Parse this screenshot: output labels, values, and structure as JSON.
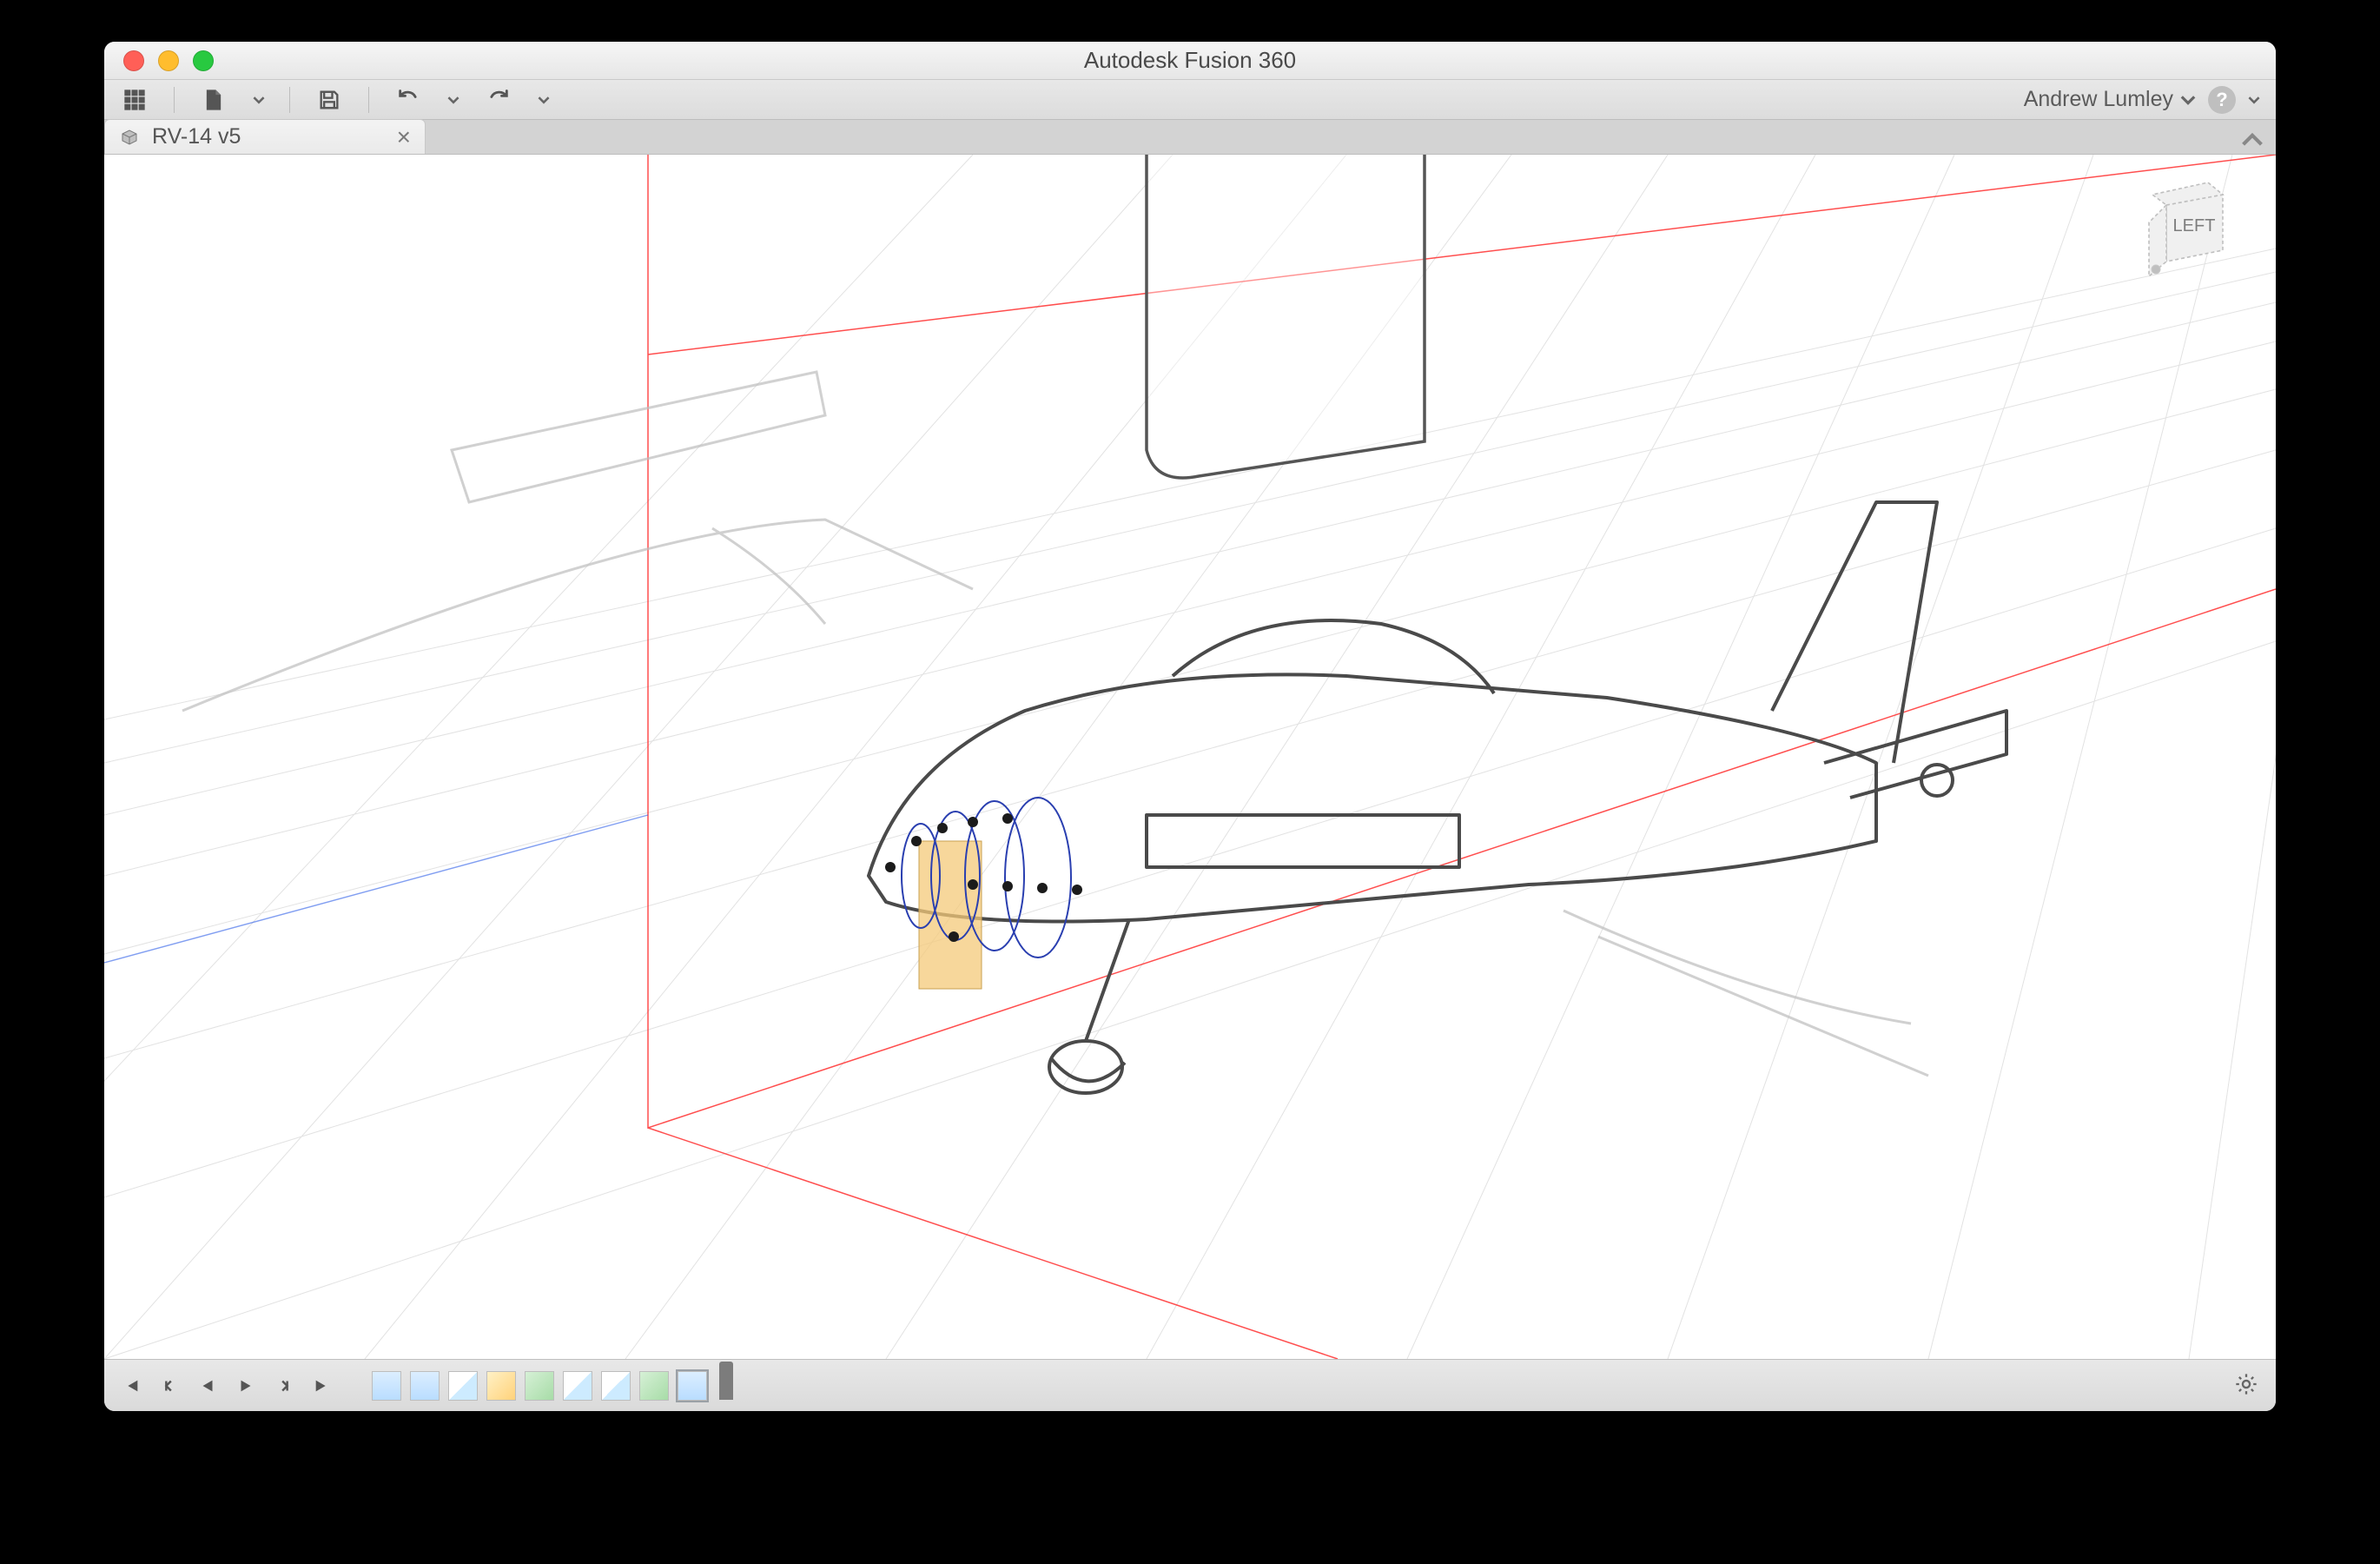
{
  "window": {
    "title": "Autodesk Fusion 360"
  },
  "user": {
    "name": "Andrew Lumley"
  },
  "tabs": [
    {
      "label": "RV-14 v5",
      "icon": "component-icon"
    }
  ],
  "viewcube": {
    "face": "LEFT"
  },
  "toolbar": {
    "items": [
      {
        "name": "data-panel-button",
        "icon": "grid"
      },
      {
        "name": "file-menu-button",
        "icon": "file",
        "dropdown": true
      },
      {
        "name": "save-button",
        "icon": "save"
      },
      {
        "name": "undo-button",
        "icon": "undo",
        "dropdown": true
      },
      {
        "name": "redo-button",
        "icon": "redo",
        "dropdown": true
      }
    ]
  },
  "timeline": {
    "transport": [
      {
        "name": "timeline-start-button",
        "icon": "skip-start"
      },
      {
        "name": "timeline-step-back-button",
        "icon": "step-back"
      },
      {
        "name": "timeline-play-back-button",
        "icon": "play-rev"
      },
      {
        "name": "timeline-play-button",
        "icon": "play"
      },
      {
        "name": "timeline-step-fwd-button",
        "icon": "step-fwd"
      },
      {
        "name": "timeline-end-button",
        "icon": "skip-end"
      }
    ],
    "history": [
      {
        "name": "history-canvas-1",
        "kind": "canvas"
      },
      {
        "name": "history-canvas-2",
        "kind": "canvas"
      },
      {
        "name": "history-sketch-1",
        "kind": "sketch"
      },
      {
        "name": "history-warning-1",
        "kind": "warn"
      },
      {
        "name": "history-plane-1",
        "kind": "plane"
      },
      {
        "name": "history-sketch-2",
        "kind": "sketch"
      },
      {
        "name": "history-sketch-3",
        "kind": "sketch"
      },
      {
        "name": "history-plane-2",
        "kind": "plane"
      },
      {
        "name": "history-sketch-4",
        "kind": "sketch-sel"
      }
    ]
  }
}
